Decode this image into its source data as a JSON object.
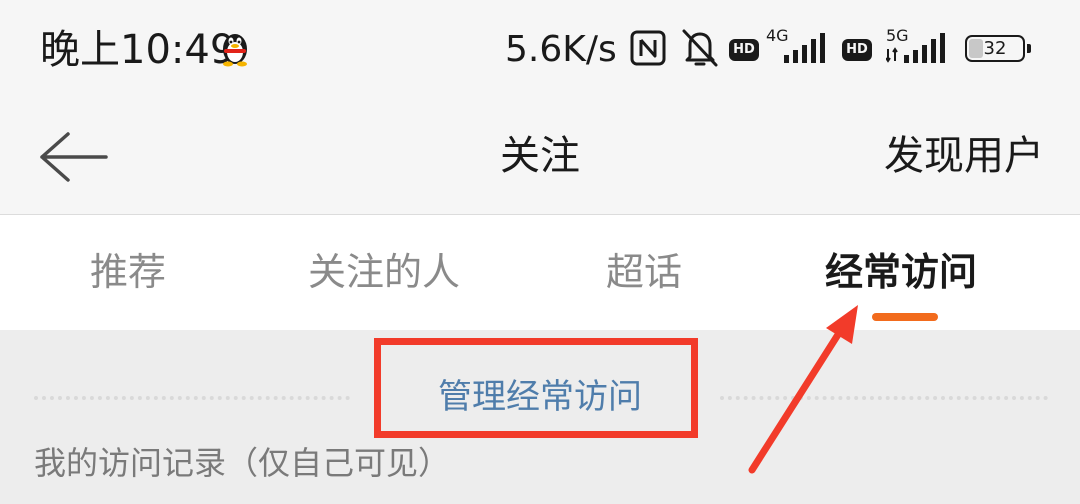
{
  "status_bar": {
    "time": "晚上10:49",
    "net_speed": "5.6K/s",
    "hd_label": "HD",
    "sim1_network": "4G",
    "sim2_network": "5G",
    "battery_level": "32",
    "battery_fraction": 0.32,
    "icons": [
      "qq-penguin-icon",
      "nfc-icon",
      "bell-muted-icon",
      "signal-bars-icon",
      "battery-icon"
    ]
  },
  "header": {
    "back_icon": "arrow-left-icon",
    "title": "关注",
    "action_label": "发现用户"
  },
  "tabs": [
    {
      "label": "推荐",
      "active": false
    },
    {
      "label": "关注的人",
      "active": false
    },
    {
      "label": "超话",
      "active": false
    },
    {
      "label": "经常访问",
      "active": true
    }
  ],
  "content": {
    "manage_label": "管理经常访问",
    "history_label": "我的访问记录（仅自己可见）"
  },
  "colors": {
    "accent": "#f26b1d",
    "link": "#4f7dab",
    "annotation": "#f23b2a",
    "background": "#f6f6f6",
    "content_background": "#ededed"
  }
}
